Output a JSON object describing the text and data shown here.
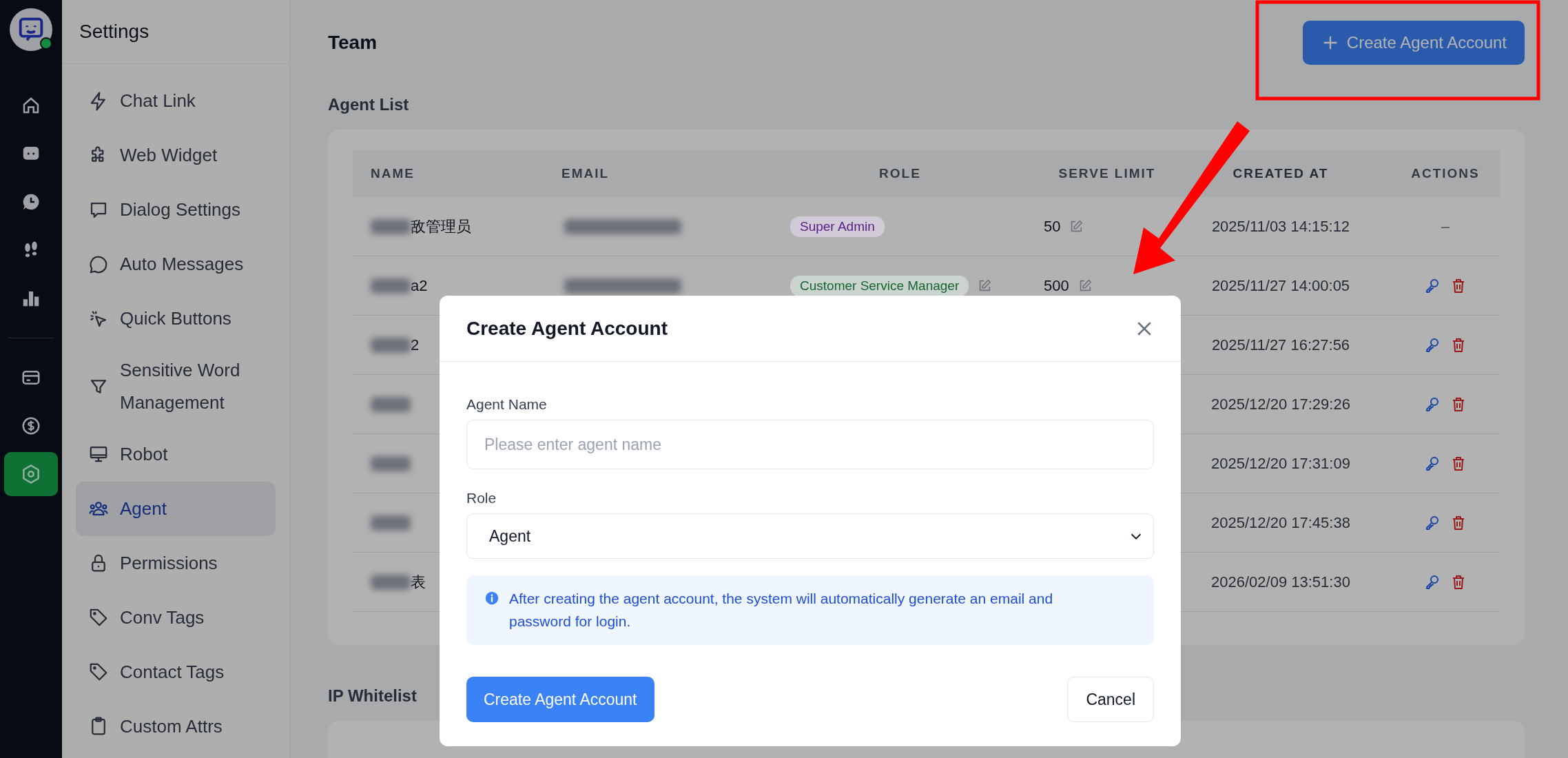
{
  "avatar": {
    "online": true
  },
  "rail_top": [
    {
      "kind": "home",
      "selected": false
    },
    {
      "kind": "chat",
      "selected": false
    },
    {
      "kind": "clock",
      "selected": false
    },
    {
      "kind": "footprints",
      "selected": false
    },
    {
      "kind": "chart",
      "selected": false
    }
  ],
  "rail_bottom": [
    {
      "kind": "card",
      "selected": false
    },
    {
      "kind": "dollar",
      "selected": false
    },
    {
      "kind": "settings",
      "selected": true
    }
  ],
  "sidebar": {
    "title": "Settings",
    "items": [
      {
        "label": "Chat Link",
        "kind": "bolt",
        "selected": false
      },
      {
        "label": "Web Widget",
        "kind": "puzzle",
        "selected": false
      },
      {
        "label": "Dialog Settings",
        "kind": "dialog",
        "selected": false
      },
      {
        "label": "Auto Messages",
        "kind": "message",
        "selected": false
      },
      {
        "label": "Quick Buttons",
        "kind": "cursor",
        "selected": false
      },
      {
        "label": "Sensitive Word Management",
        "kind": "filter",
        "selected": false
      },
      {
        "label": "Robot",
        "kind": "monitor",
        "selected": false
      },
      {
        "label": "Agent",
        "kind": "users",
        "selected": true
      },
      {
        "label": "Permissions",
        "kind": "lock",
        "selected": false
      },
      {
        "label": "Conv Tags",
        "kind": "tag",
        "selected": false
      },
      {
        "label": "Contact Tags",
        "kind": "tag",
        "selected": false
      },
      {
        "label": "Custom Attrs",
        "kind": "clipboard",
        "selected": false
      }
    ]
  },
  "page": {
    "title": "Team",
    "create_button": "Create Agent Account"
  },
  "agent_list": {
    "title": "Agent List",
    "columns": [
      "NAME",
      "EMAIL",
      "ROLE",
      "SERVE LIMIT",
      "CREATED AT",
      "ACTIONS"
    ],
    "rows": [
      {
        "name": "敌管理员",
        "role": {
          "label": "Super Admin",
          "color": "#581c87",
          "editable": false
        },
        "serve_limit": "50",
        "created_at": "2025/11/03 14:15:12",
        "actions": {
          "kind": "text",
          "text": "–"
        }
      },
      {
        "name": "a2",
        "role": {
          "label": "Customer Service Manager",
          "color": "#166534",
          "editable": true
        },
        "serve_limit": "500",
        "created_at": "2025/11/27 14:00:05",
        "actions": {
          "kind": "icons"
        }
      },
      {
        "name": "2",
        "created_at": "2025/11/27 16:27:56",
        "actions": {
          "kind": "icons"
        }
      },
      {
        "created_at": "2025/12/20 17:29:26",
        "actions": {
          "kind": "icons"
        }
      },
      {
        "created_at": "2025/12/20 17:31:09",
        "actions": {
          "kind": "icons"
        }
      },
      {
        "created_at": "2025/12/20 17:45:38",
        "actions": {
          "kind": "icons"
        }
      },
      {
        "name": "表",
        "created_at": "2026/02/09 13:51:30",
        "actions": {
          "kind": "icons"
        }
      }
    ]
  },
  "ip_whitelist": {
    "title": "IP Whitelist"
  },
  "modal": {
    "title": "Create Agent Account",
    "fields": [
      {
        "kind": "text",
        "label": "Agent Name",
        "placeholder": "Please enter agent name"
      },
      {
        "kind": "select",
        "label": "Role",
        "value": "Agent"
      }
    ],
    "info": "After creating the agent account, the system will automatically generate an email and password for login.",
    "submit": "Create Agent Account",
    "cancel": "Cancel"
  }
}
